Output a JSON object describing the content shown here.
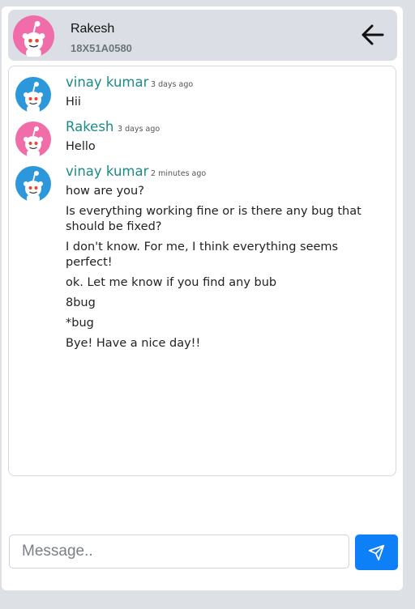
{
  "header": {
    "contact_name": "Rakesh",
    "contact_id": "18X51A0580",
    "back_icon": "arrow-left-icon"
  },
  "messages": [
    {
      "sender": "vinay kumar",
      "time": "3 days ago",
      "avatar": "reddit-blue-avatar",
      "lines": [
        "Hii"
      ]
    },
    {
      "sender": "Rakesh",
      "time": "3 days ago",
      "avatar": "reddit-pink-avatar",
      "lines": [
        "Hello"
      ]
    },
    {
      "sender": "vinay kumar",
      "time": "2 minutes ago",
      "avatar": "reddit-blue-avatar",
      "lines": [
        "how are you?",
        "Is everything working fine or is there any bug that should be fixed?",
        "I don't know. For me, I think everything seems perfect!",
        "ok. Let me know if you find any bub",
        "8bug",
        "*bug",
        "Bye! Have a nice day!!"
      ]
    }
  ],
  "composer": {
    "placeholder": "Message..",
    "send_icon": "send-icon"
  },
  "colors": {
    "accent": "#0d7ff7",
    "sender_name": "#1c8a86",
    "blue_avatar": "#2d97dc",
    "pink_avatar": "#f16daa"
  }
}
